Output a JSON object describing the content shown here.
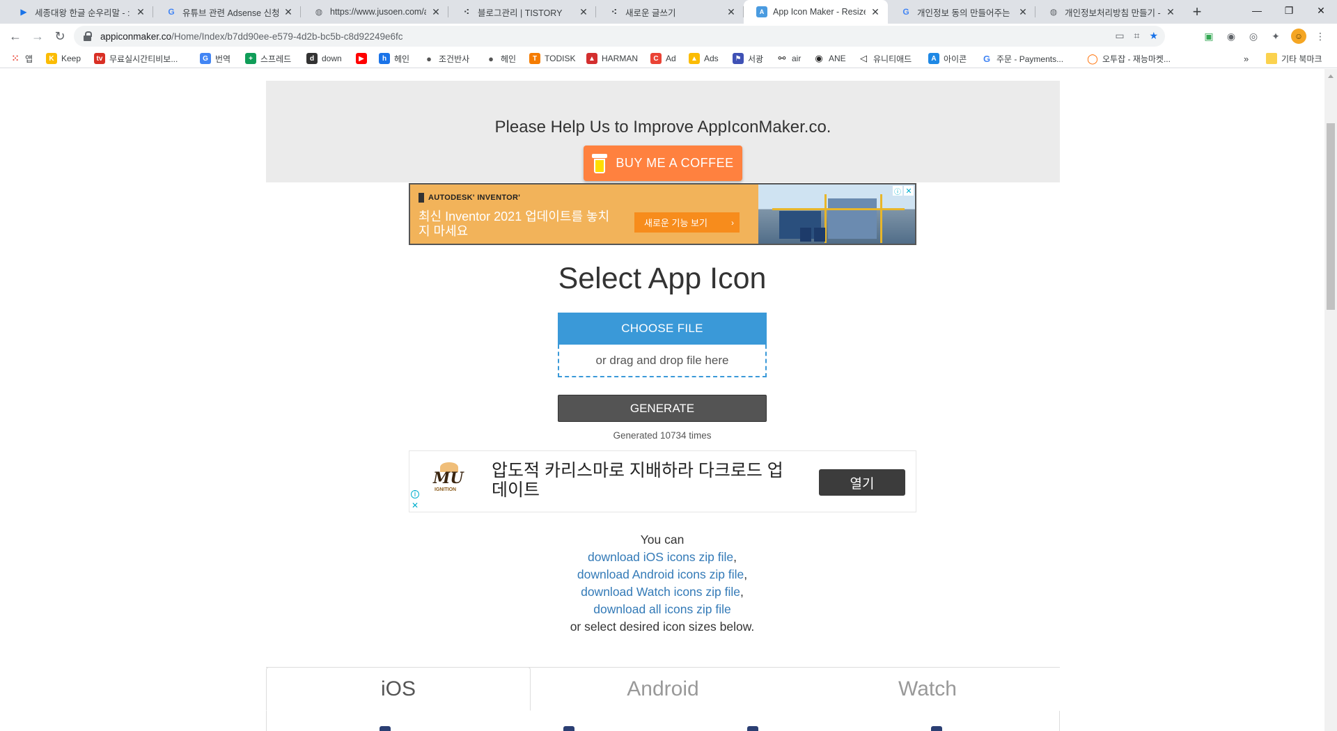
{
  "browser": {
    "tabs": [
      {
        "title": "세종대왕 한글 순우리말 - :",
        "favicon": "play-icon",
        "favicon_color": "#1a73e8"
      },
      {
        "title": "유튜브 관련 Adsense 신청하",
        "favicon": "google-icon",
        "favicon_color": "#4285f4"
      },
      {
        "title": "https://www.jusoen.com/ac",
        "favicon": "globe-icon",
        "favicon_color": "#5f6368"
      },
      {
        "title": "블로그관리 | TISTORY",
        "favicon": "tistory-icon",
        "favicon_color": "#3c4043"
      },
      {
        "title": "새로운 글쓰기",
        "favicon": "tistory-icon",
        "favicon_color": "#3c4043"
      },
      {
        "title": "App Icon Maker - Resize A",
        "favicon": "appicon-icon",
        "favicon_color": "#4a9be0"
      },
      {
        "title": "개인정보 동의 만들어주는",
        "favicon": "google-icon",
        "favicon_color": "#4285f4"
      },
      {
        "title": "개인정보처리방침 만들기 -",
        "favicon": "globe-icon",
        "favicon_color": "#5f6368"
      }
    ],
    "active_tab_index": 5,
    "url_host": "appiconmaker.co",
    "url_path": "/Home/Index/b7dd90ee-e579-4d2b-bc5b-c8d92249e6fc",
    "bookmarks": [
      {
        "label": "앱",
        "color": "#ea4335"
      },
      {
        "label": "Keep",
        "color": "#fbbc04"
      },
      {
        "label": "무료실시간티비보...",
        "color": "#d93025"
      },
      {
        "label": "번역",
        "color": "#4285f4"
      },
      {
        "label": "스프레드",
        "color": "#0f9d58"
      },
      {
        "label": "down",
        "color": "#333333"
      },
      {
        "label": "",
        "color": "#ff0000"
      },
      {
        "label": "헤인",
        "color": "#1a73e8"
      },
      {
        "label": "조건반사",
        "color": "#555555"
      },
      {
        "label": "헤인",
        "color": "#555555"
      },
      {
        "label": "TODISK",
        "color": "#f57c00"
      },
      {
        "label": "HARMAN",
        "color": "#d32f2f"
      },
      {
        "label": "Ad",
        "color": "#ea4335"
      },
      {
        "label": "Ads",
        "color": "#fbbc04"
      },
      {
        "label": "서광",
        "color": "#3f51b5"
      },
      {
        "label": "air",
        "color": "#222222"
      },
      {
        "label": "ANE",
        "color": "#222222"
      },
      {
        "label": "유니티애드",
        "color": "#222222"
      },
      {
        "label": "아이콘",
        "color": "#1e88e5"
      },
      {
        "label": "주문 - Payments...",
        "color": "#4285f4"
      },
      {
        "label": "오투잡 - 재능마켓...",
        "color": "#ff6d00"
      }
    ],
    "other_bookmarks": "기타 북마크",
    "more_bookmarks": "»"
  },
  "help": {
    "title": "Please Help Us to Improve AppIconMaker.co.",
    "coffee_label": "BUY ME A COFFEE"
  },
  "ad_inventor": {
    "brand": "AUTODESK' INVENTOR'",
    "headline": "최신 Inventor 2021 업데이트를 놓치지 마세요",
    "cta": "새로운 기능 보기",
    "cta_arrow": "›"
  },
  "main": {
    "title": "Select App Icon",
    "choose_label": "CHOOSE FILE",
    "drop_label": "or drag and drop file here",
    "generate_label": "GENERATE",
    "generated_count": "Generated 10734 times"
  },
  "ad_mu": {
    "logo_text": "MU",
    "logo_sub": "IGNITION",
    "headline": "압도적 카리스마로 지배하라 다크로드 업데이트",
    "button": "열기"
  },
  "download": {
    "intro": "You can",
    "links": [
      {
        "text": "download iOS icons zip file",
        "suffix": ","
      },
      {
        "text": "download Android icons zip file",
        "suffix": ","
      },
      {
        "text": "download Watch icons zip file",
        "suffix": ","
      },
      {
        "text": "download all icons zip file",
        "suffix": ""
      }
    ],
    "outro": "or select desired icon sizes below."
  },
  "os_tabs": [
    {
      "label": "iOS",
      "active": true
    },
    {
      "label": "Android",
      "active": false
    },
    {
      "label": "Watch",
      "active": false
    }
  ]
}
